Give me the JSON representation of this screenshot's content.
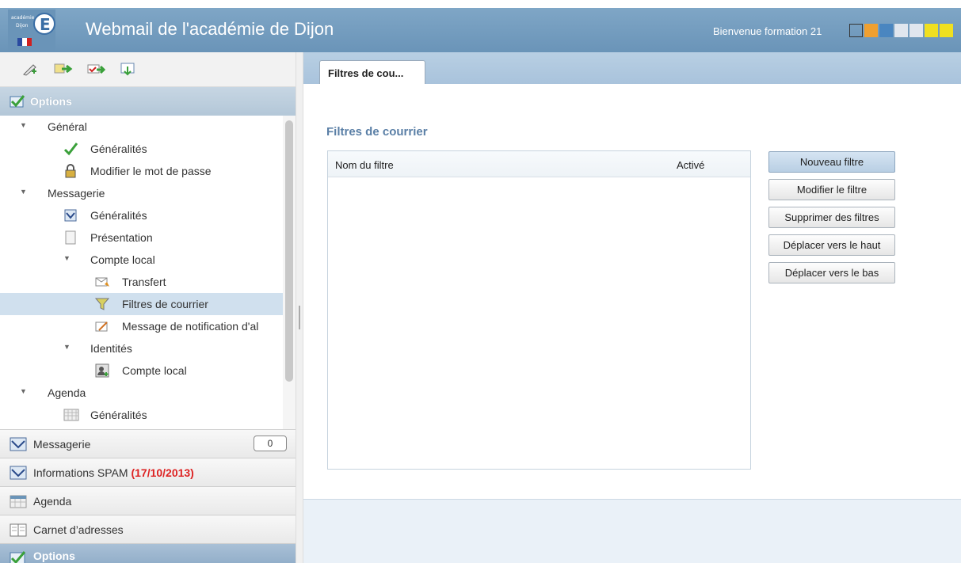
{
  "header": {
    "app_title": "Webmail de l'académie de Dijon",
    "welcome": "Bienvenue formation 21",
    "logo_text": "académie Dijon E",
    "swatch_colors": [
      "#ffffff",
      "#f0a030",
      "#4a86c0",
      "#e0e6ee",
      "#e0e6ee",
      "#f0e020",
      "#f0e020"
    ]
  },
  "toolbar": {
    "icons": [
      "new-icon",
      "forward-icon",
      "move-icon",
      "import-icon"
    ]
  },
  "options_panel": {
    "title": "Options"
  },
  "tree": {
    "general": "Général",
    "general_generalites": "Généralités",
    "change_password": "Modifier le mot de passe",
    "messagerie": "Messagerie",
    "messagerie_generalites": "Généralités",
    "presentation": "Présentation",
    "compte_local": "Compte local",
    "transfert": "Transfert",
    "filtres": "Filtres de courrier",
    "notification": "Message de notification d'al",
    "identites": "Identités",
    "identites_compte_local": "Compte local",
    "agenda": "Agenda",
    "agenda_generalites": "Généralités"
  },
  "accordion": {
    "messagerie": "Messagerie",
    "messagerie_count": "0",
    "spam": "Informations SPAM",
    "spam_date": "(17/10/2013)",
    "agenda": "Agenda",
    "carnet": "Carnet d’adresses",
    "options": "Options"
  },
  "content": {
    "tab_label": "Filtres de cou...",
    "section_title": "Filtres de courrier",
    "columns": [
      "Nom du filtre",
      "Activé"
    ],
    "rows": [],
    "buttons": {
      "new": "Nouveau filtre",
      "edit": "Modifier le filtre",
      "delete": "Supprimer des filtres",
      "up": "Déplacer vers le haut",
      "down": "Déplacer vers le bas"
    }
  }
}
